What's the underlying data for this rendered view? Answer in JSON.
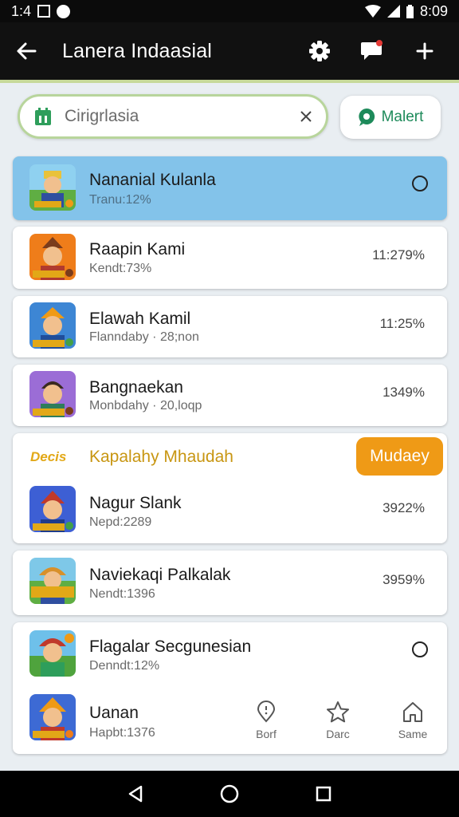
{
  "status_bar": {
    "time_left": "1:4",
    "time_right": "8:09"
  },
  "toolbar": {
    "title": "Lanera Indaasial"
  },
  "search": {
    "placeholder": "Cirigrlasia",
    "button_label": "Malert"
  },
  "rows": [
    {
      "name": "Nananial Kulanla",
      "sub": "Tranu:12%",
      "value": ""
    },
    {
      "name": "Raapin Kami",
      "sub": "Kendt:73%",
      "value": "11:279%"
    },
    {
      "name": "Elawah Kamil",
      "sub": "Flanndaby · 28;non",
      "value": "11:25%"
    },
    {
      "name": "Bangnaekan",
      "sub": "Monbdahy · 20,loqp",
      "value": "1349%"
    }
  ],
  "section": {
    "logo": "Decis",
    "title": "Kapalahy Mhaudah",
    "button_label": "Mudaey"
  },
  "rows2": [
    {
      "name": "Nagur Slank",
      "sub": "Nepd:2289",
      "value": "3922%"
    },
    {
      "name": "Naviekaqi Palkalak",
      "sub": "Nendt:1396",
      "value": "3959%"
    },
    {
      "name": "Flagalar Secgunesian",
      "sub": "Denndt:12%",
      "value": ""
    },
    {
      "name": "Uanan",
      "sub": "Hapbt:1376",
      "value": ""
    }
  ],
  "bottom_nav": [
    {
      "label": "Borf",
      "icon": "location-pin-icon"
    },
    {
      "label": "Darc",
      "icon": "star-icon"
    },
    {
      "label": "Same",
      "icon": "home-icon"
    }
  ],
  "colors": {
    "accent_blue": "#83c3ea",
    "accent_orange": "#ef9a16",
    "accent_green": "#1d8a5a",
    "search_border": "#b8d59c"
  }
}
